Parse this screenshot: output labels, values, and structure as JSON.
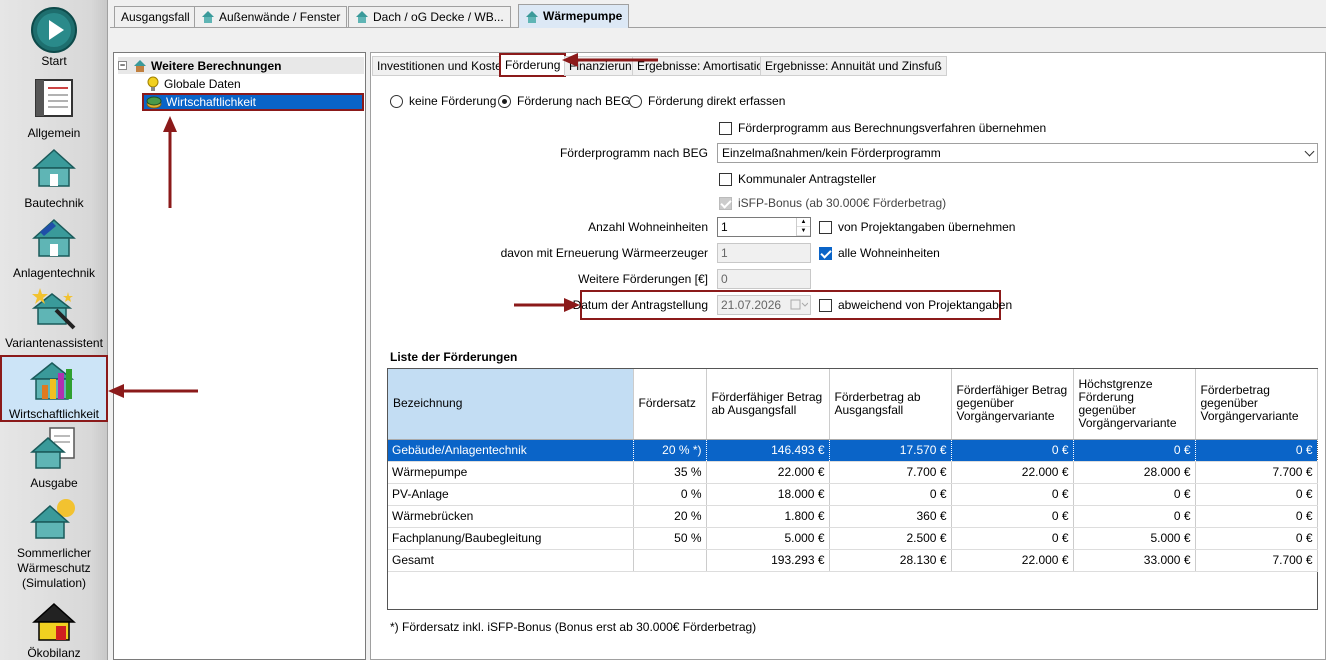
{
  "nav": {
    "items": [
      {
        "label": "Start",
        "icon": "play-icon"
      },
      {
        "label": "Allgemein",
        "icon": "notebook-icon"
      },
      {
        "label": "Bautechnik",
        "icon": "house-icon"
      },
      {
        "label": "Anlagentechnik",
        "icon": "house-solar-icon"
      },
      {
        "label": "Variantenassistent",
        "icon": "magic-wand-icon"
      },
      {
        "label": "Wirtschaftlichkeit",
        "icon": "bar-chart-icon"
      },
      {
        "label": "Ausgabe",
        "icon": "document-house-icon"
      },
      {
        "label": "Sommerlicher Wärmeschutz (Simulation)",
        "icon": "sun-house-icon"
      },
      {
        "label": "Ökobilanz",
        "icon": "eco-house-icon"
      }
    ]
  },
  "top_tabs": [
    "Ausgangsfall",
    "Außenwände / Fenster",
    "Dach / oG Decke / WB...",
    "Wärmepumpe"
  ],
  "tree": {
    "root": "Weitere Berechnungen",
    "toggle": "−",
    "children": [
      "Globale Daten",
      "Wirtschaftlichkeit"
    ]
  },
  "sub_tabs": [
    "Investitionen und Kosten",
    "Förderung",
    "Finanzierung",
    "Ergebnisse: Amortisation",
    "Ergebnisse: Annuität und Zinsfuß"
  ],
  "foerderung": {
    "radio_options": [
      "keine Förderung",
      "Förderung nach BEG",
      "Förderung direkt erfassen"
    ],
    "selected_radio": "Förderung nach BEG",
    "chk_berechnungsverfahren": "Förderprogramm aus Berechnungsverfahren übernehmen",
    "label_programm": "Förderprogramm nach BEG",
    "programm_value": "Einzelmaßnahmen/kein Förderprogramm",
    "chk_kommunal": "Kommunaler Antragsteller",
    "chk_isfp": "iSFP-Bonus (ab 30.000€ Förderbetrag)",
    "label_wohneinheiten": "Anzahl Wohneinheiten",
    "wohneinheiten_value": "1",
    "chk_projektangaben": "von Projektangaben übernehmen",
    "label_erneuerung": "davon mit Erneuerung Wärmeerzeuger",
    "erneuerung_value": "1",
    "chk_alle": "alle Wohneinheiten",
    "label_weitere": "Weitere Förderungen [€]",
    "weitere_value": "0",
    "label_datum": "Datum der Antragstellung",
    "datum_value": "21.07.2026",
    "chk_abweichend": "abweichend von Projektangaben"
  },
  "table": {
    "title": "Liste der Förderungen",
    "headers": [
      "Bezeichnung",
      "Fördersatz",
      "Förderfähiger Betrag ab Ausgangsfall",
      "Förderbetrag ab Ausgangsfall",
      "Förderfähiger Betrag gegenüber Vorgängervariante",
      "Höchstgrenze Förderung gegenüber Vorgängervariante",
      "Förderbetrag gegenüber Vorgängervariante"
    ],
    "rows": [
      [
        "Gebäude/Anlagentechnik",
        "20 % *)",
        "146.493 €",
        "17.570 €",
        "0 €",
        "0 €",
        "0 €"
      ],
      [
        "Wärmepumpe",
        "35 %",
        "22.000 €",
        "7.700 €",
        "22.000 €",
        "28.000 €",
        "7.700 €"
      ],
      [
        "PV-Anlage",
        "0 %",
        "18.000 €",
        "0 €",
        "0 €",
        "0 €",
        "0 €"
      ],
      [
        "Wärmebrücken",
        "20 %",
        "1.800 €",
        "360 €",
        "0 €",
        "0 €",
        "0 €"
      ],
      [
        "Fachplanung/Baubegleitung",
        "50 %",
        "5.000 €",
        "2.500 €",
        "0 €",
        "5.000 €",
        "0 €"
      ],
      [
        "Gesamt",
        "",
        "193.293 €",
        "28.130 €",
        "22.000 €",
        "33.000 €",
        "7.700 €"
      ]
    ]
  },
  "footnote": "*) Fördersatz inkl. iSFP-Bonus (Bonus erst ab 30.000€ Förderbetrag)",
  "colors": {
    "accent": "#0a64c8",
    "callout": "#8b1a1a",
    "header_selected": "#c3ddf3"
  }
}
